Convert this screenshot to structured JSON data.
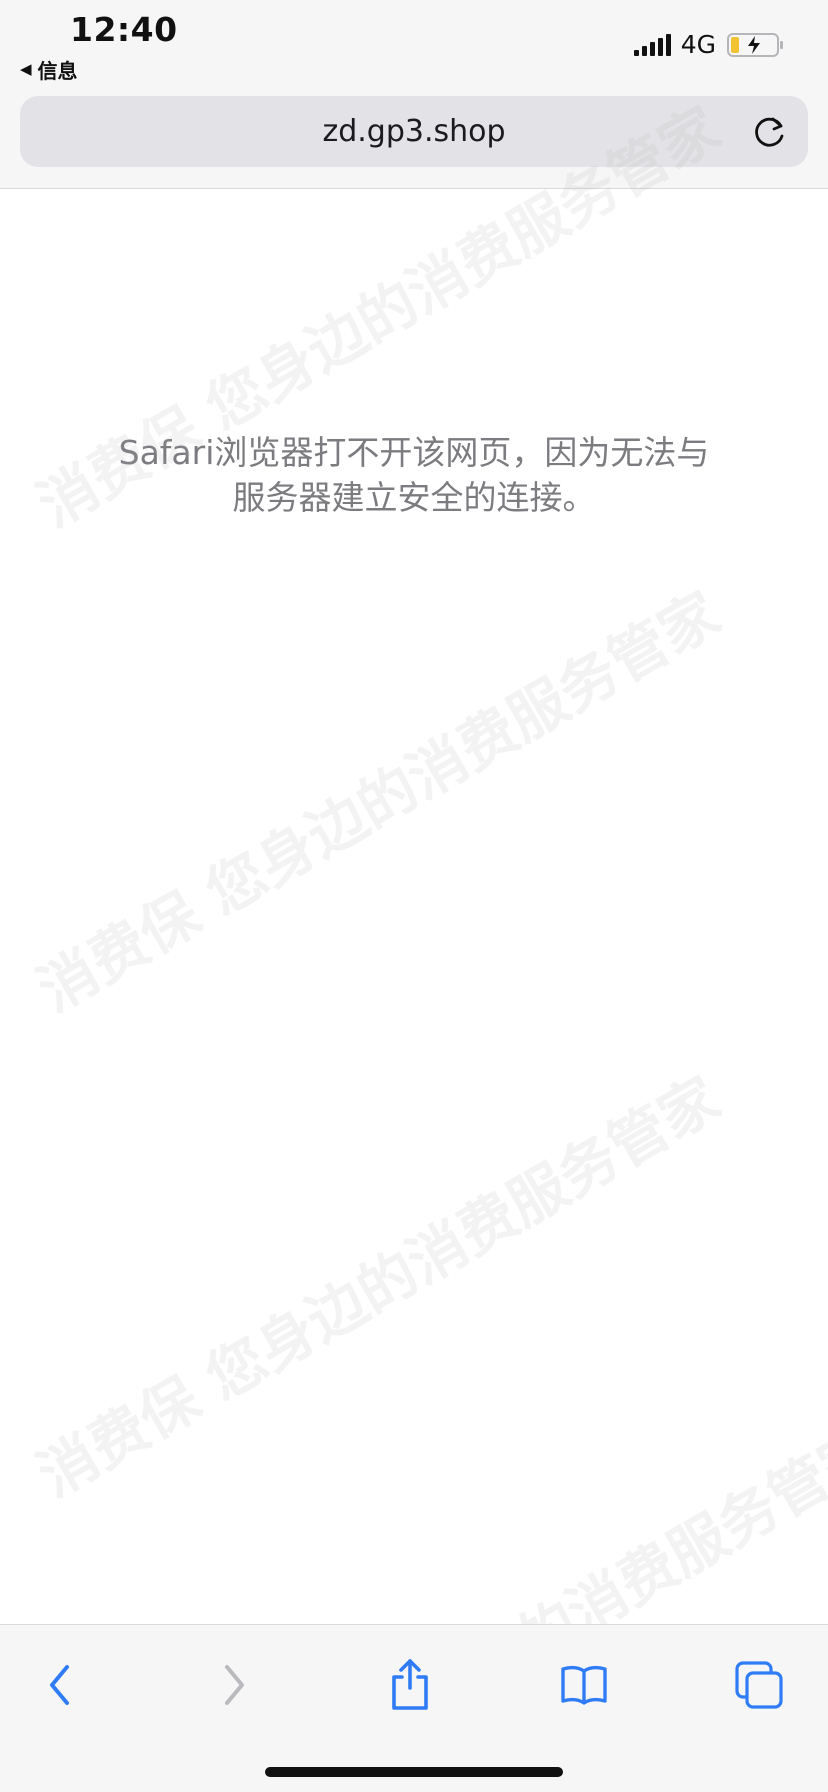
{
  "status_bar": {
    "time": "12:40",
    "back_app_label": "信息",
    "network": "4G"
  },
  "address_bar": {
    "url": "zd.gp3.shop"
  },
  "main": {
    "error_line_1": "Safari浏览器打不开该网页，因为无法与",
    "error_line_2": "服务器建立安全的连接。"
  },
  "watermark": {
    "text": "消费保 您身边的消费服务管家"
  },
  "colors": {
    "accent": "#2f7cf6",
    "chrome_bg": "#f6f6f7",
    "url_bar_bg": "#e3e3e7",
    "message_text": "#7c7c80",
    "disabled": "#b9b9be"
  },
  "toolbar": {
    "icons": [
      "back-icon",
      "forward-icon",
      "share-icon",
      "bookmarks-icon",
      "tabs-icon"
    ]
  }
}
